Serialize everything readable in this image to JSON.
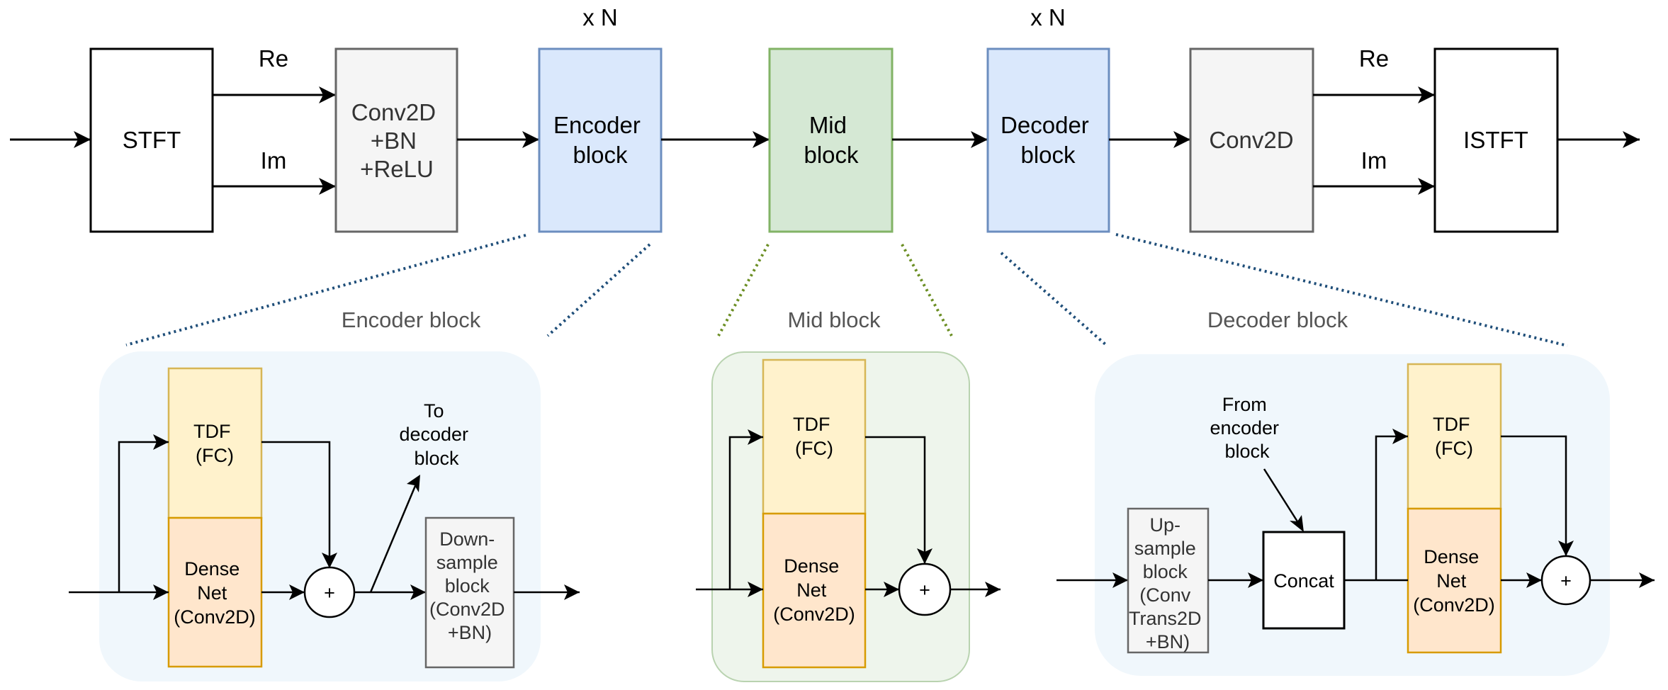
{
  "top_row": {
    "repeat_labels": [
      "x N",
      "x N"
    ],
    "stft": {
      "label": "STFT"
    },
    "re_label_1": "Re",
    "im_label_1": "Im",
    "conv_in": {
      "lines": [
        "Conv2D",
        "+BN",
        "+ReLU"
      ]
    },
    "encoder": {
      "lines": [
        "Encoder",
        "block"
      ]
    },
    "mid": {
      "lines": [
        "Mid",
        "block"
      ]
    },
    "decoder": {
      "lines": [
        "Decoder",
        "block"
      ]
    },
    "conv_out": {
      "label": "Conv2D"
    },
    "re_label_2": "Re",
    "im_label_2": "Im",
    "istft": {
      "label": "ISTFT"
    }
  },
  "encoder_detail": {
    "title": "Encoder block",
    "tdf": {
      "lines": [
        "TDF",
        "(FC)"
      ]
    },
    "densenet": {
      "lines": [
        "Dense",
        "Net",
        "(Conv2D)"
      ]
    },
    "sum": "+",
    "skip_note": {
      "lines": [
        "To",
        "decoder",
        "block"
      ]
    },
    "downsample": {
      "lines": [
        "Down-",
        "sample",
        "block",
        "(Conv2D",
        "+BN)"
      ]
    }
  },
  "mid_detail": {
    "title": "Mid block",
    "tdf": {
      "lines": [
        "TDF",
        "(FC)"
      ]
    },
    "densenet": {
      "lines": [
        "Dense",
        "Net",
        "(Conv2D)"
      ]
    },
    "sum": "+"
  },
  "decoder_detail": {
    "title": "Decoder block",
    "upsample": {
      "lines": [
        "Up-",
        "sample",
        "block",
        "(Conv",
        "Trans2D",
        "+BN)"
      ]
    },
    "skip_note": {
      "lines": [
        "From",
        "encoder",
        "block"
      ]
    },
    "concat": {
      "label": "Concat"
    },
    "tdf": {
      "lines": [
        "TDF",
        "(FC)"
      ]
    },
    "densenet": {
      "lines": [
        "Dense",
        "Net",
        "(Conv2D)"
      ]
    },
    "sum": "+"
  },
  "colors": {
    "encoder_fill": "#dae8fc",
    "encoder_stroke": "#6c8ebf",
    "mid_fill": "#d5e8d4",
    "mid_stroke": "#82b366",
    "gray_fill": "#f5f5f5",
    "gray_stroke": "#666666",
    "tdf_fill": "#fff2cc",
    "tdf_stroke": "#d6b656",
    "dense_fill": "#ffe6cc",
    "dense_stroke": "#d79b00",
    "enc_dec_panel": "#f0f7fc",
    "mid_panel": "#eef5ec",
    "dotted_blue": "#1f4e79",
    "dotted_green": "#6b8e23"
  }
}
